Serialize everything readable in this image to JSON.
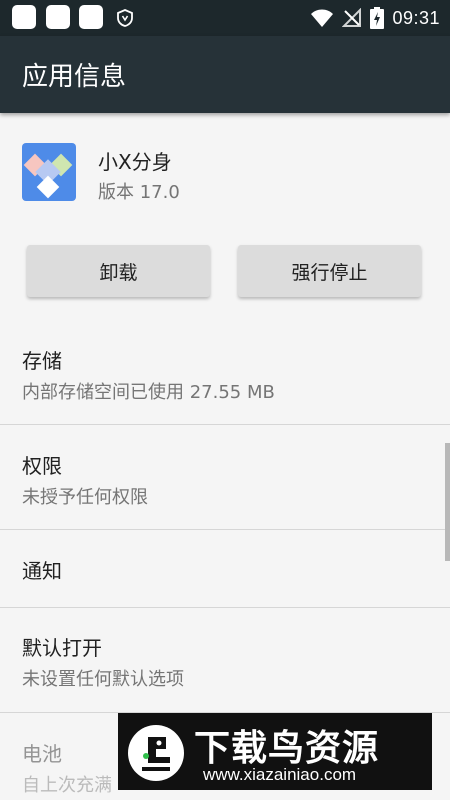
{
  "status_bar": {
    "time": "09:31",
    "icons": [
      "notification-square-icon",
      "notification-square-icon",
      "notification-square-icon",
      "shield-icon",
      "wifi-icon",
      "no-signal-icon",
      "battery-charging-icon"
    ]
  },
  "app_bar": {
    "title": "应用信息"
  },
  "app": {
    "name": "小X分身",
    "version": "版本 17.0"
  },
  "buttons": {
    "uninstall": "卸载",
    "force_stop": "强行停止"
  },
  "rows": {
    "storage": {
      "title": "存储",
      "subtitle": "内部存储空间已使用 27.55 MB"
    },
    "permissions": {
      "title": "权限",
      "subtitle": "未授予任何权限"
    },
    "notifications": {
      "title": "通知"
    },
    "open_by_default": {
      "title": "默认打开",
      "subtitle": "未设置任何默认选项"
    },
    "battery": {
      "title": "电池",
      "subtitle": "自上次充满"
    }
  },
  "watermark": {
    "brand": "下载鸟资源",
    "url": "www.xiazainiao.com"
  },
  "colors": {
    "status_bar": "#1d282c",
    "app_bar": "#263238",
    "background": "#f5f5f5",
    "app_icon": "#4e8be8"
  }
}
